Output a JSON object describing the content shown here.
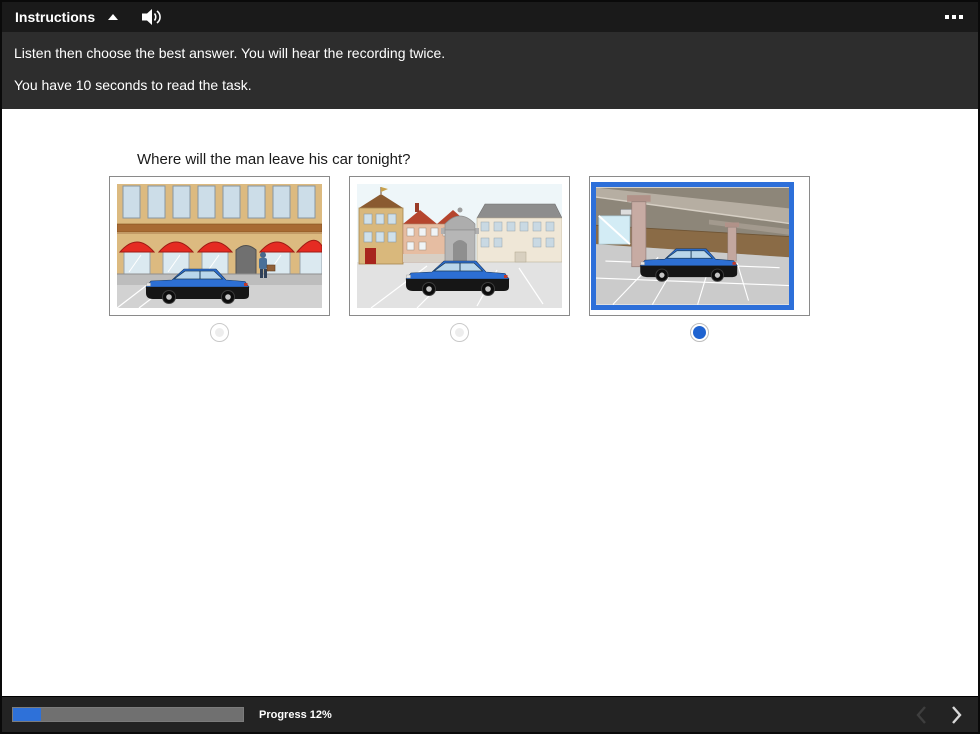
{
  "header": {
    "title": "Instructions",
    "icons": {
      "collapse": "caret-up",
      "audio": "speaker",
      "menu": "ellipsis"
    }
  },
  "instructions": {
    "line1": "Listen then choose the best answer. You will hear the recording twice.",
    "line2": "You have 10 seconds to read the task."
  },
  "question": "Where will the man leave his car tonight?",
  "options": [
    {
      "scene": "car-parked-on-street",
      "selected": false
    },
    {
      "scene": "car-parked-in-town-square",
      "selected": false
    },
    {
      "scene": "car-parked-in-indoor-car-park",
      "selected": true
    }
  ],
  "footer": {
    "progress_label": "Progress 12%",
    "progress_percent": 12,
    "prev_enabled": false,
    "next_enabled": true,
    "icons": {
      "prev": "chevron-left",
      "next": "chevron-right"
    }
  },
  "colors": {
    "header_bg": "#1a1a1a",
    "instructions_bg": "#2d2d2d",
    "footer_bg": "#232323",
    "selection_blue": "#2d6fd9",
    "radio_selected": "#1f63d0",
    "progress_fill": "#2e71d9",
    "progress_track": "#707070"
  }
}
